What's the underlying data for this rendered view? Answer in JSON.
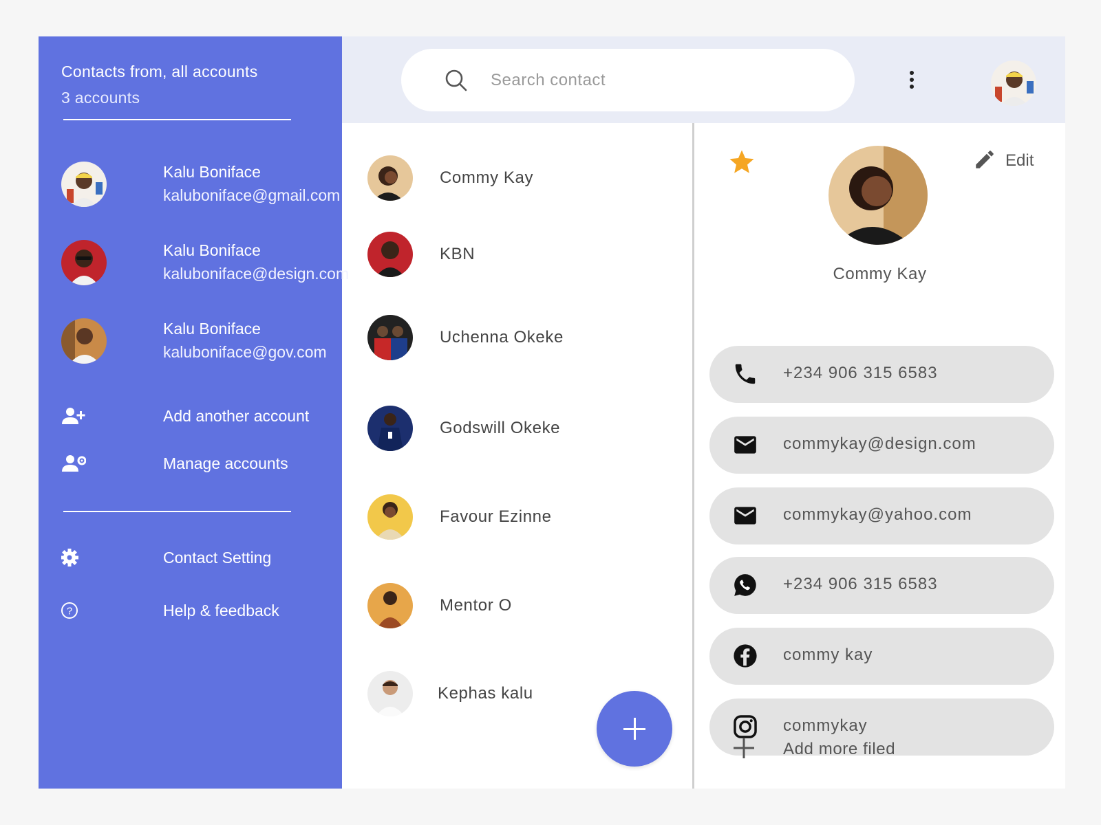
{
  "sidebar": {
    "title": "Contacts from, all accounts",
    "subtitle": "3 accounts",
    "accounts": [
      {
        "name": "Kalu Boniface",
        "email": "kaluboniface@gmail.com"
      },
      {
        "name": "Kalu Boniface",
        "email": "kaluboniface@design.com"
      },
      {
        "name": "Kalu Boniface",
        "email": "kaluboniface@gov.com"
      }
    ],
    "add_account_label": "Add another account",
    "manage_accounts_label": "Manage accounts",
    "contact_setting_label": "Contact Setting",
    "help_label": "Help & feedback"
  },
  "search": {
    "placeholder": "Search contact",
    "value": ""
  },
  "contacts": [
    {
      "name": "Commy Kay"
    },
    {
      "name": "KBN"
    },
    {
      "name": "Uchenna Okeke"
    },
    {
      "name": "Godswill Okeke"
    },
    {
      "name": "Favour Ezinne"
    },
    {
      "name": "Mentor O"
    },
    {
      "name": "Kephas kalu"
    }
  ],
  "details": {
    "edit_label": "Edit",
    "name": "Commy Kay",
    "fields": [
      {
        "icon": "phone-icon",
        "value": "+234 906 315 6583"
      },
      {
        "icon": "mail-icon",
        "value": "commykay@design.com"
      },
      {
        "icon": "mail-icon",
        "value": "commykay@yahoo.com"
      },
      {
        "icon": "whatsapp-icon",
        "value": "+234 906 315 6583"
      },
      {
        "icon": "facebook-icon",
        "value": "commy kay"
      },
      {
        "icon": "instagram-icon",
        "value": "commykay"
      }
    ],
    "add_more_label": "Add more filed"
  },
  "colors": {
    "primary": "#6072e0",
    "topbar": "#e9ecf6",
    "field_bg": "#e3e3e3",
    "star": "#f5a623"
  }
}
